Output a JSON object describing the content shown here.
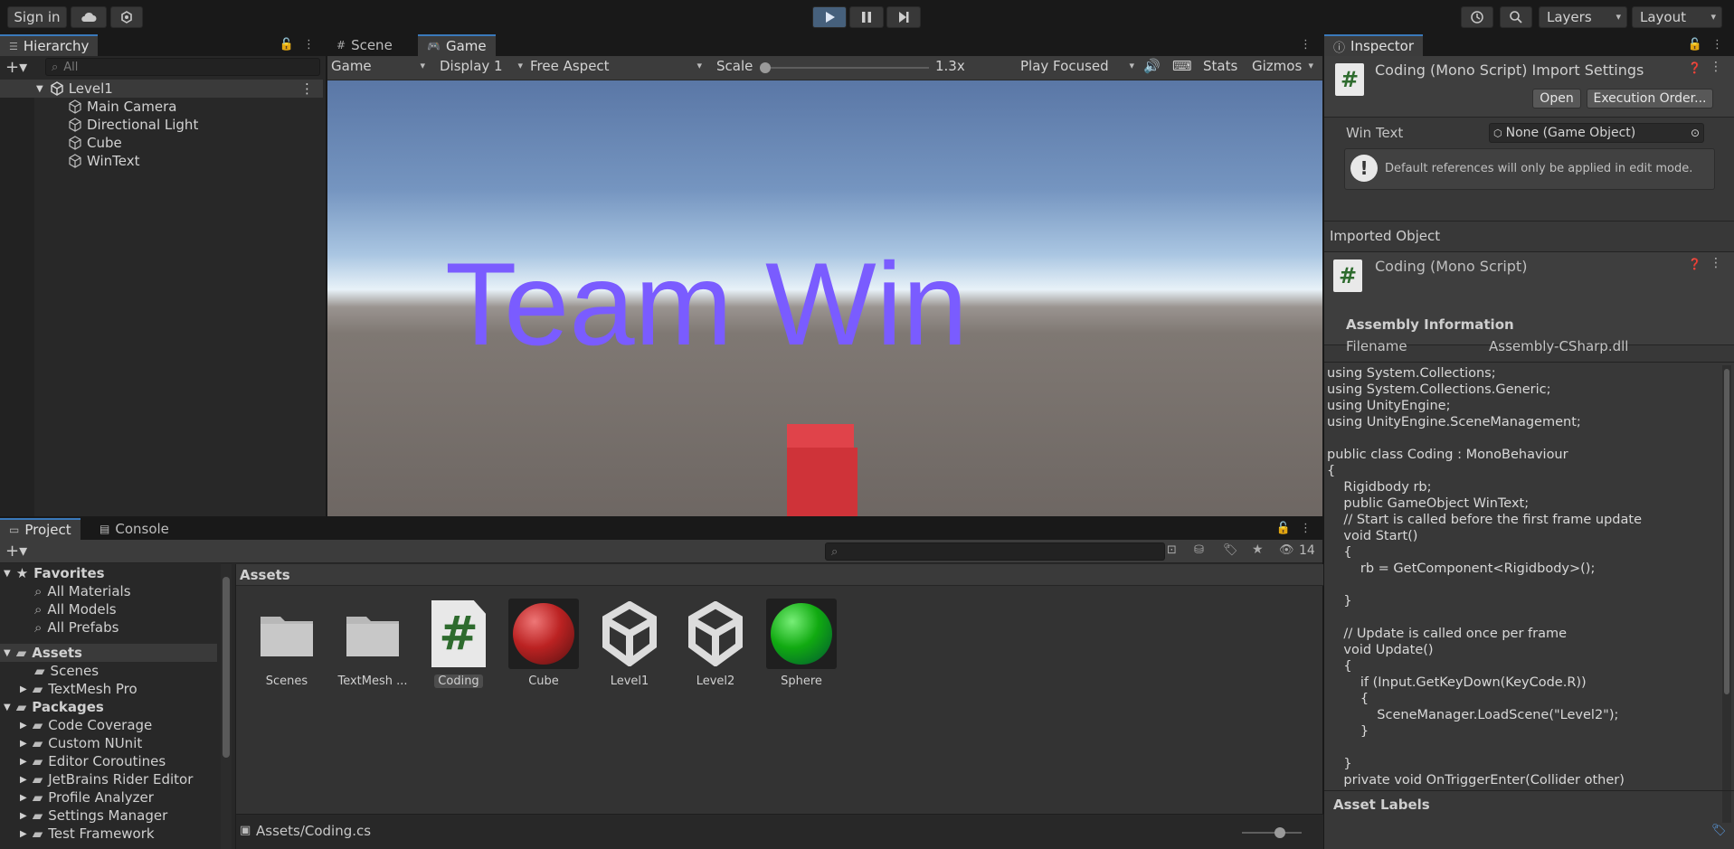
{
  "toolbar": {
    "sign_in": "Sign in",
    "layers": "Layers",
    "layout": "Layout"
  },
  "hierarchy": {
    "tab": "Hierarchy",
    "search_placeholder": "All",
    "scene": "Level1",
    "items": [
      "Main Camera",
      "Directional Light",
      "Cube",
      "WinText"
    ]
  },
  "game_view": {
    "tabs": [
      "Scene",
      "Game"
    ],
    "mode": "Game",
    "display": "Display 1",
    "aspect": "Free Aspect",
    "scale_label": "Scale",
    "scale_value": "1.3x",
    "play_mode": "Play Focused",
    "stats": "Stats",
    "gizmos": "Gizmos",
    "win_text": "Team Win",
    "win_color": "#7a5cff",
    "cube_color": "#d63a40"
  },
  "inspector": {
    "tab": "Inspector",
    "title": "Coding (Mono Script) Import Settings",
    "open_btn": "Open",
    "exec_btn": "Execution Order...",
    "field_label": "Win Text",
    "field_value": "None (Game Object)",
    "warning": "Default references will only be applied in edit mode.",
    "imported_header": "Imported Object",
    "imported_name": "Coding (Mono Script)",
    "assembly_header": "Assembly Information",
    "filename_label": "Filename",
    "filename_value": "Assembly-CSharp.dll",
    "code": "using System.Collections;\nusing System.Collections.Generic;\nusing UnityEngine;\nusing UnityEngine.SceneManagement;\n\npublic class Coding : MonoBehaviour\n{\n    Rigidbody rb;\n    public GameObject WinText;\n    // Start is called before the first frame update\n    void Start()\n    {\n        rb = GetComponent<Rigidbody>();\n\n    }\n\n    // Update is called once per frame\n    void Update()\n    {\n        if (Input.GetKeyDown(KeyCode.R))\n        {\n            SceneManager.LoadScene(\"Level2\");\n        }\n\n    }\n    private void OnTriggerEnter(Collider other)",
    "asset_labels": "Asset Labels"
  },
  "project": {
    "tabs": [
      "Project",
      "Console"
    ],
    "hidden_count": "14",
    "favorites_header": "Favorites",
    "favorites": [
      "All Materials",
      "All Models",
      "All Prefabs"
    ],
    "assets_header": "Assets",
    "asset_folders": [
      "Scenes",
      "TextMesh Pro"
    ],
    "packages_header": "Packages",
    "packages": [
      "Code Coverage",
      "Custom NUnit",
      "Editor Coroutines",
      "JetBrains Rider Editor",
      "Profile Analyzer",
      "Settings Manager",
      "Test Framework"
    ],
    "breadcrumb": "Assets",
    "grid": [
      "Scenes",
      "TextMesh ...",
      "Coding",
      "Cube",
      "Level1",
      "Level2",
      "Sphere"
    ],
    "status_path": "Assets/Coding.cs"
  }
}
